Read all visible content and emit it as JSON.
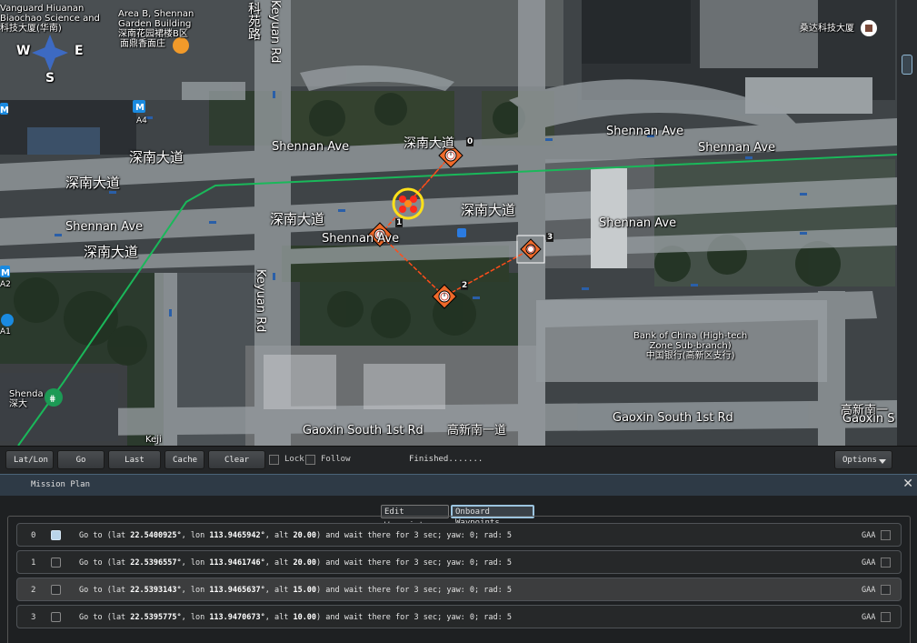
{
  "map": {
    "labels": {
      "vanguard": "Vanguard Hiuanan\nBiaochao Science and\n科技大厦(华南)",
      "area_b": "Area B, Shennan\nGarden Building\n深南花园裙楼B区",
      "restaurant": "面鼎香面庄",
      "road_v1": "科苑路",
      "road_v2": "Keyuan Rd",
      "road_v2b": "Keyuan Rd",
      "sangda": "桑达科技大厦",
      "metro_a4": "A4",
      "metro_a2": "A2",
      "metro_a1": "A1",
      "shennan_cn_1": "深南大道",
      "shennan_cn_2": "深南大道",
      "shennan_cn_3": "深南大道",
      "shennan_cn_4": "深南大道",
      "shennan_cn_5": "深南大道",
      "shennan_cn_6": "深南大道",
      "shennan_en_1": "Shennan Ave",
      "shennan_en_2": "Shennan Ave",
      "shennan_en_3": "Shennan Ave",
      "shennan_en_4": "Shennan Ave",
      "shennan_en_5": "Shennan Ave",
      "shennan_en_6": "Shennan Ave",
      "boc": "Bank of China (High-tech\nZone Sub-branch)\n中国银行(高新区支行)",
      "shenda": "Shenda\n深大",
      "gaoxin_1": "Gaoxin South 1st Rd",
      "gaoxin_2": "高新南一道",
      "gaoxin_3": "Gaoxin South 1st Rd",
      "gaoxin_4": "高新南一",
      "gaoxin_5": "Gaoxin S",
      "keji": "Keji",
      "compass_w": "W",
      "compass_e": "E",
      "compass_s": "S"
    },
    "waypoint_labels": [
      "0",
      "1",
      "2",
      "3"
    ],
    "colors": {
      "route": "#ff4d1a",
      "home_ring": "#ffe11a",
      "boundary_line": "#1ab85a",
      "road": "#8c9196"
    }
  },
  "toolbar": {
    "lat_lon": "Lat/Lon",
    "go_home": "Go Home",
    "last_pos": "Last Pos",
    "cache": "Cache",
    "clear_map": "Clear Map",
    "lock": "Lock",
    "follow": "Follow",
    "status": "Finished.......",
    "options": "Options"
  },
  "mission": {
    "title": "Mission Plan",
    "close": "✕",
    "tabs": {
      "edit": "Edit Waypoints",
      "onboard": "Onboard Waypoints"
    },
    "waypoints": [
      {
        "idx": "0",
        "pre": "Go to (lat ",
        "lat": "22.5400925°",
        "mid1": ", lon ",
        "lon": "113.9465942°",
        "mid2": ", alt ",
        "alt": "20.00",
        "post": ") and wait there for 3 sec; yaw: 0; rad: 5",
        "gaa": "GAA",
        "checked": true
      },
      {
        "idx": "1",
        "pre": "Go to (lat ",
        "lat": "22.5396557°",
        "mid1": ", lon ",
        "lon": "113.9461746°",
        "mid2": ", alt ",
        "alt": "20.00",
        "post": ") and wait there for 3 sec; yaw: 0; rad: 5",
        "gaa": "GAA",
        "checked": false
      },
      {
        "idx": "2",
        "pre": "Go to (lat ",
        "lat": "22.5393143°",
        "mid1": ", lon ",
        "lon": "113.9465637°",
        "mid2": ", alt ",
        "alt": "15.00",
        "post": ") and wait there for 3 sec; yaw: 0; rad: 5",
        "gaa": "GAA",
        "checked": false
      },
      {
        "idx": "3",
        "pre": "Go to (lat ",
        "lat": "22.5395775°",
        "mid1": ", lon ",
        "lon": "113.9470673°",
        "mid2": ", alt ",
        "alt": "10.00",
        "post": ") and wait there for 3 sec; yaw: 0; rad: 5",
        "gaa": "GAA",
        "checked": false
      }
    ]
  }
}
